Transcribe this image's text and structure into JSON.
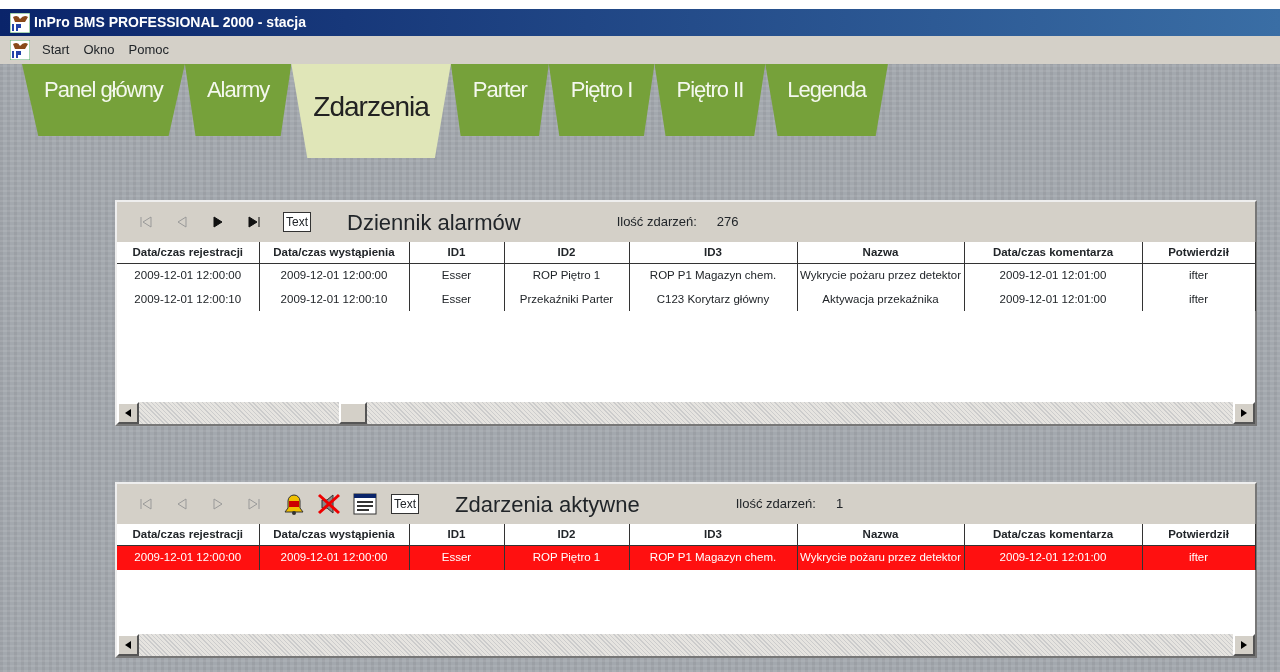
{
  "window": {
    "title": "InPro BMS PROFESSIONAL 2000 - stacja"
  },
  "menu": [
    "Start",
    "Okno",
    "Pomoc"
  ],
  "tabs": [
    {
      "label": "Panel główny",
      "selected": false
    },
    {
      "label": "Alarmy",
      "selected": false
    },
    {
      "label": "Zdarzenia",
      "selected": true
    },
    {
      "label": "Parter",
      "selected": false
    },
    {
      "label": "Piętro I",
      "selected": false
    },
    {
      "label": "Piętro II",
      "selected": false
    },
    {
      "label": "Legenda",
      "selected": false
    }
  ],
  "panels": [
    {
      "title": "Dziennik alarmów",
      "count_label": "Ilość zdarzeń:",
      "count": "276",
      "filter_text": "Text",
      "nav": [
        {
          "kind": "first",
          "disabled": true
        },
        {
          "kind": "prev",
          "disabled": true
        },
        {
          "kind": "next",
          "disabled": false
        },
        {
          "kind": "last",
          "disabled": false
        }
      ],
      "columns": [
        "Data/czas rejestracji",
        "Data/czas wystąpienia",
        "ID1",
        "ID2",
        "ID3",
        "Nazwa",
        "Data/czas komentarza",
        "Potwierdził"
      ],
      "rows": [
        {
          "active": false,
          "cells": [
            "2009-12-01 12:00:00",
            "2009-12-01 12:00:00",
            "Esser",
            "ROP Piętro 1",
            "ROP P1 Magazyn chem.",
            "Wykrycie pożaru przez detektor",
            "2009-12-01 12:01:00",
            "ifter"
          ]
        },
        {
          "active": false,
          "cells": [
            "2009-12-01 12:00:10",
            "2009-12-01 12:00:10",
            "Esser",
            "Przekaźniki Parter",
            "C123 Korytarz główny",
            "Aktywacja przekaźnika",
            "2009-12-01 12:01:00",
            "ifter"
          ]
        }
      ]
    },
    {
      "title": "Zdarzenia aktywne",
      "count_label": "Ilość zdarzeń:",
      "count": "1",
      "filter_text": "Text",
      "nav": [
        {
          "kind": "first",
          "disabled": true
        },
        {
          "kind": "prev",
          "disabled": true
        },
        {
          "kind": "next",
          "disabled": true
        },
        {
          "kind": "last",
          "disabled": true
        }
      ],
      "tools": [
        {
          "kind": "bell"
        },
        {
          "kind": "mute"
        },
        {
          "kind": "list"
        }
      ],
      "columns": [
        "Data/czas rejestracji",
        "Data/czas wystąpienia",
        "ID1",
        "ID2",
        "ID3",
        "Nazwa",
        "Data/czas komentarza",
        "Potwierdził"
      ],
      "rows": [
        {
          "active": true,
          "cells": [
            "2009-12-01 12:00:00",
            "2009-12-01 12:00:00",
            "Esser",
            "ROP Piętro 1",
            "ROP P1 Magazyn chem.",
            "Wykrycie pożaru przez detektor",
            "2009-12-01 12:01:00",
            "ifter"
          ]
        }
      ]
    }
  ]
}
